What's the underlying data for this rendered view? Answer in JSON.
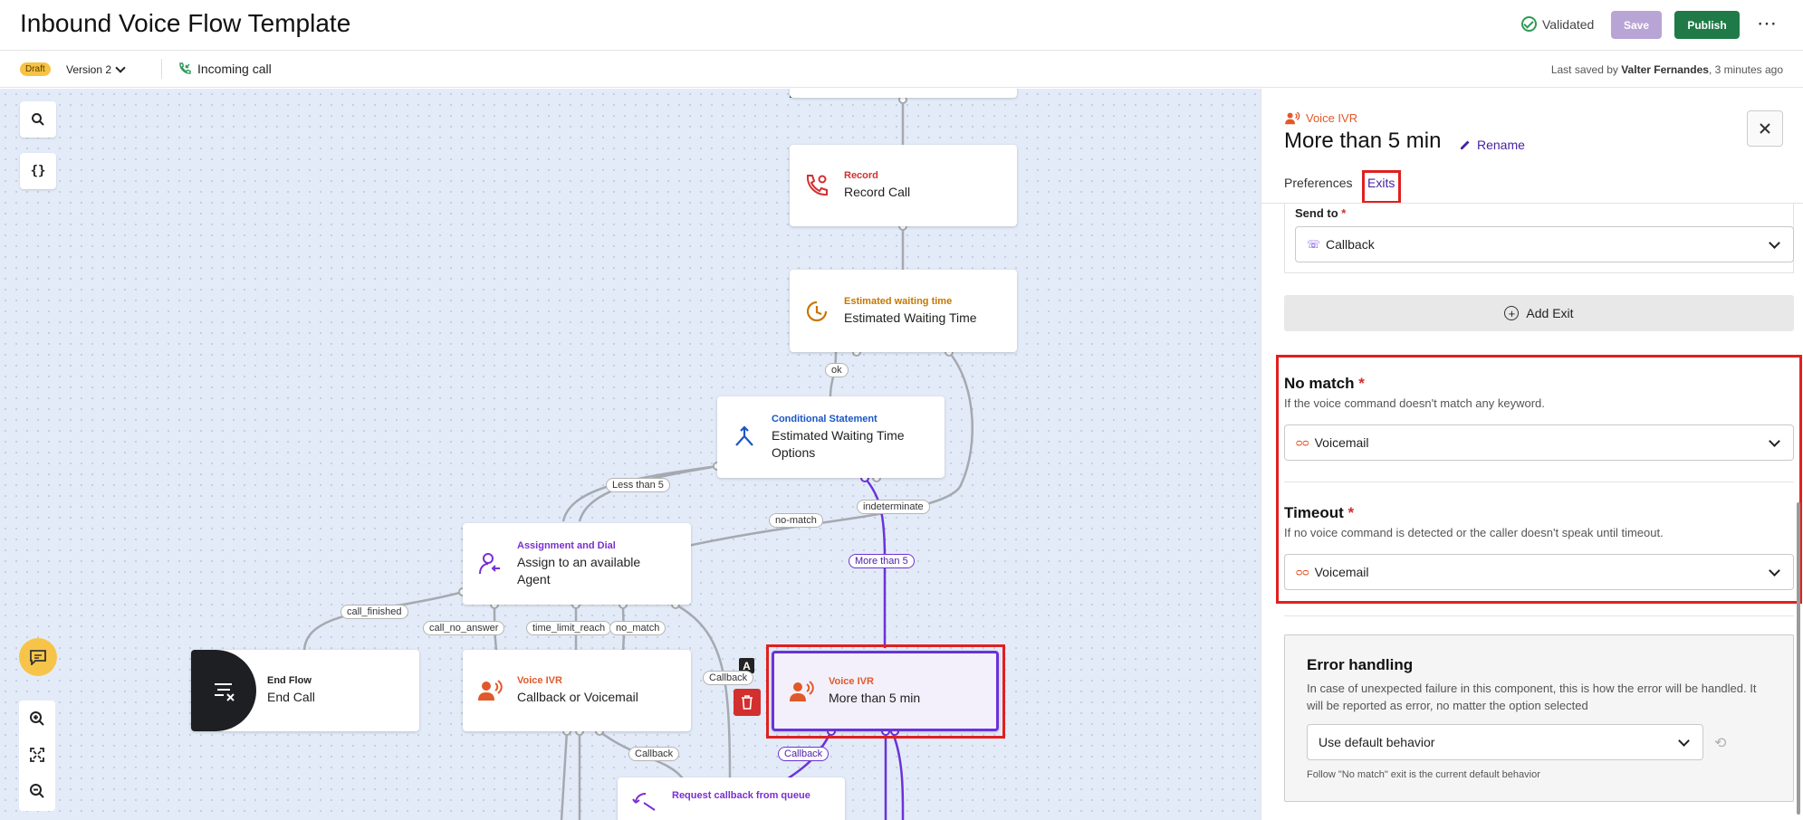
{
  "header": {
    "title": "Inbound Voice Flow Template",
    "validated": "Validated",
    "save": "Save",
    "publish": "Publish",
    "more": "⋯"
  },
  "subheader": {
    "draft": "Draft",
    "version": "Version 2",
    "incoming": "Incoming call",
    "last_saved_prefix": "Last saved by ",
    "last_saved_user": "Valter Fernandes",
    "last_saved_suffix": ", 3 minutes ago"
  },
  "canvas": {
    "tools": {
      "search": "⌕",
      "variables": "{}",
      "zoom_in": "⊕",
      "fit": "⤢",
      "zoom_out": "⊖"
    },
    "nodes": [
      {
        "cat": "Record",
        "label": "Record Call",
        "cat_color": "#d32f2f"
      },
      {
        "cat": "Estimated waiting time",
        "label": "Estimated Waiting Time",
        "cat_color": "#c77700"
      },
      {
        "cat": "Conditional Statement",
        "label": "Estimated Waiting Time Options",
        "cat_color": "#1a56c4"
      },
      {
        "cat": "Assignment and Dial",
        "label": "Assign to an available Agent",
        "cat_color": "#7a2fd0"
      },
      {
        "cat": "End Flow",
        "label": "End Call",
        "cat_color": "#222222"
      },
      {
        "cat": "Voice IVR",
        "label": "Callback or Voicemail",
        "cat_color": "#e0592a"
      },
      {
        "cat": "Voice IVR",
        "label": "More than 5 min",
        "cat_color": "#e0592a"
      },
      {
        "cat": "Request callback from queue",
        "label": "",
        "cat_color": "#7a2fd0"
      }
    ],
    "edges": {
      "ok": "ok",
      "less_than_5": "Less than 5",
      "indeterminate": "indeterminate",
      "no_match": "no-match",
      "more_than_5": "More than 5",
      "call_finished": "call_finished",
      "call_no_answer": "call_no_answer",
      "time_limit": "time_limit_reach",
      "no_match_2": "no_match",
      "callback_1": "Callback",
      "callback_2": "Callback",
      "callback_3": "Callback"
    },
    "selected_badge": "A"
  },
  "panel": {
    "category": "Voice IVR",
    "title": "More than 5 min",
    "rename": "Rename",
    "tabs": [
      "Preferences",
      "Exits"
    ],
    "active_tab": "Exits",
    "send_to_label": "Send to",
    "send_to_value": "Callback",
    "add_exit": "Add Exit",
    "no_match": {
      "title": "No match",
      "desc": "If the voice command doesn't match any keyword.",
      "value": "Voicemail"
    },
    "timeout": {
      "title": "Timeout",
      "desc": "If no voice command is detected or the caller doesn't speak until timeout.",
      "value": "Voicemail"
    },
    "error_handling": {
      "title": "Error handling",
      "desc": "In case of unexpected failure in this component, this is how the error will be handled. It will be reported as error, no matter the option selected",
      "value": "Use default behavior",
      "hint": "Follow \"No match\" exit is the current default behavior"
    }
  },
  "colors": {
    "accent": "#4a1fa3",
    "publish": "#1f7a47",
    "save_disabled": "#b9a4d6",
    "highlight": "#e02020",
    "ivr": "#e0592a"
  }
}
